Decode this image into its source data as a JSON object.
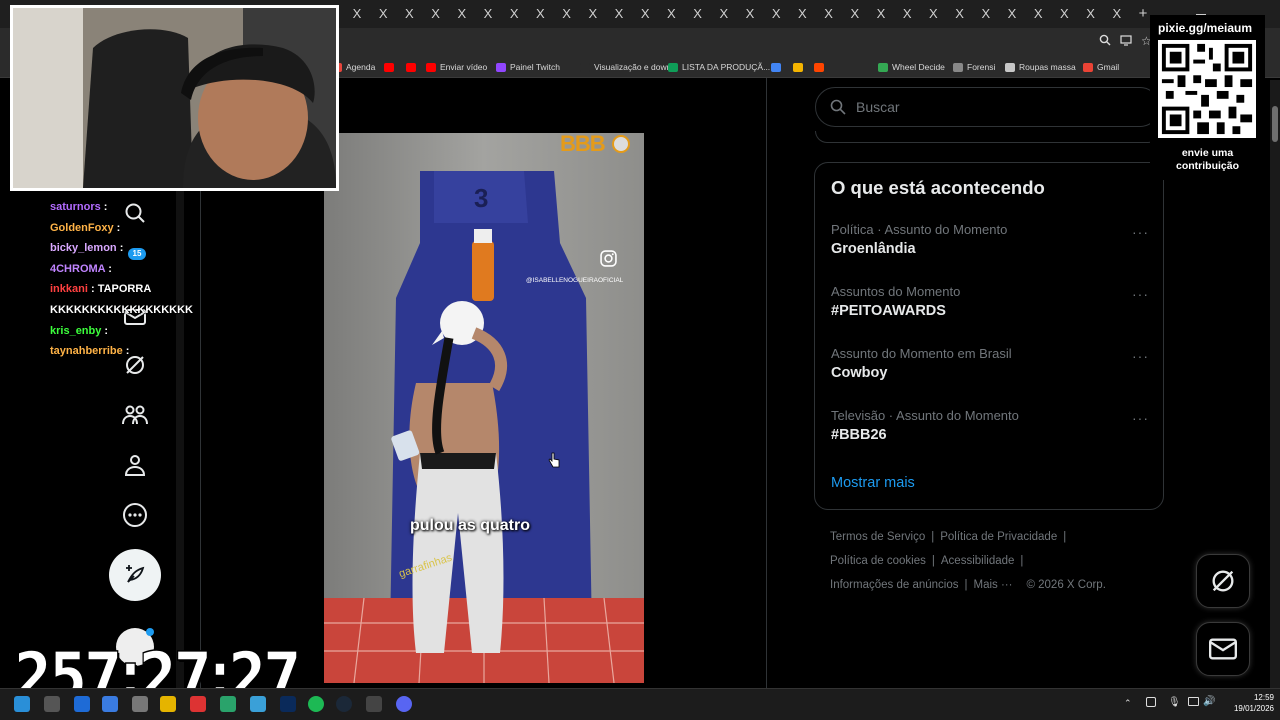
{
  "browser": {
    "tab_close_glyph": "X",
    "new_tab_glyph": "+",
    "bookmarks": [
      {
        "label": "Agenda",
        "color": "#e8453c"
      },
      {
        "label": "",
        "color": "#ff0000"
      },
      {
        "label": "",
        "color": "#ff0000"
      },
      {
        "label": "Enviar vídeo",
        "color": "#ff0000"
      },
      {
        "label": "Painel Twitch",
        "color": "#9146ff"
      },
      {
        "label": "Visualização e down...",
        "color": "#2b2b2b"
      },
      {
        "label": "LISTA DA PRODUÇÃ...",
        "color": "#0f9d58"
      },
      {
        "label": "",
        "color": "#4285f4"
      },
      {
        "label": "",
        "color": "#f4b400"
      },
      {
        "label": "",
        "color": "#ff4500"
      },
      {
        "label": "Wheel Decide",
        "color": "#34a853"
      },
      {
        "label": "Forensi",
        "color": "#888888"
      },
      {
        "label": "Roupas massa",
        "color": "#c7c7c7"
      },
      {
        "label": "Gmail",
        "color": "#ea4335"
      }
    ]
  },
  "search": {
    "placeholder": "Buscar"
  },
  "trends": {
    "title": "O que está acontecendo",
    "items": [
      {
        "meta": "Política · Assunto do Momento",
        "name": "Groenlândia"
      },
      {
        "meta": "Assuntos do Momento",
        "name": "#PEITOAWARDS"
      },
      {
        "meta": "Assunto do Momento em Brasil",
        "name": "Cowboy"
      },
      {
        "meta": "Televisão · Assunto do Momento",
        "name": "#BBB26"
      }
    ],
    "more_label": "···",
    "show_more": "Mostrar mais"
  },
  "footer": {
    "links_row1": [
      "Termos de Serviço",
      "Política de Privacidade"
    ],
    "links_row2": [
      "Política de cookies",
      "Acessibilidade"
    ],
    "links_row3": [
      "Informações de anúncios",
      "Mais ···"
    ],
    "copyright": "© 2026 X Corp.",
    "separator": "|"
  },
  "video": {
    "caption": "pulou as quatro",
    "watermark": "@ISABELLENOGUEIRAOFICIAL",
    "sticker": "garrafinhas",
    "logo": "BBB",
    "counter": "3"
  },
  "overlay": {
    "qr_title": "pixie.gg/meiaum",
    "qr_caption_1": "envie uma",
    "qr_caption_2": "contribuição",
    "timer": "257:27:27",
    "notification_count": "15",
    "chat": [
      {
        "user": "saturnors",
        "sep": " :",
        "msg": "",
        "color": "#b36bff"
      },
      {
        "user": "GoldenFoxy",
        "sep": " :",
        "msg": "",
        "color": "#ffb347"
      },
      {
        "user": "bicky_lemon",
        "sep": " :",
        "msg": "",
        "color": "#d9a8ff"
      },
      {
        "user": "4CHROMA",
        "sep": " :",
        "msg": "",
        "color": "#c084ff"
      },
      {
        "user": "inkkani",
        "sep": " :",
        "msg": " TAPORRA",
        "color": "#ff4040"
      },
      {
        "user": "",
        "sep": "",
        "msg": "KKKKKKKKKKKKKKKKKK",
        "color": "#ffffff"
      },
      {
        "user": "kris_enby",
        "sep": " :",
        "msg": "",
        "color": "#3cff3c"
      },
      {
        "user": "taynahberribe",
        "sep": " :",
        "msg": "",
        "color": "#ffb347"
      }
    ]
  },
  "taskbar": {
    "time": "12:59",
    "date": "19/01/2026"
  }
}
